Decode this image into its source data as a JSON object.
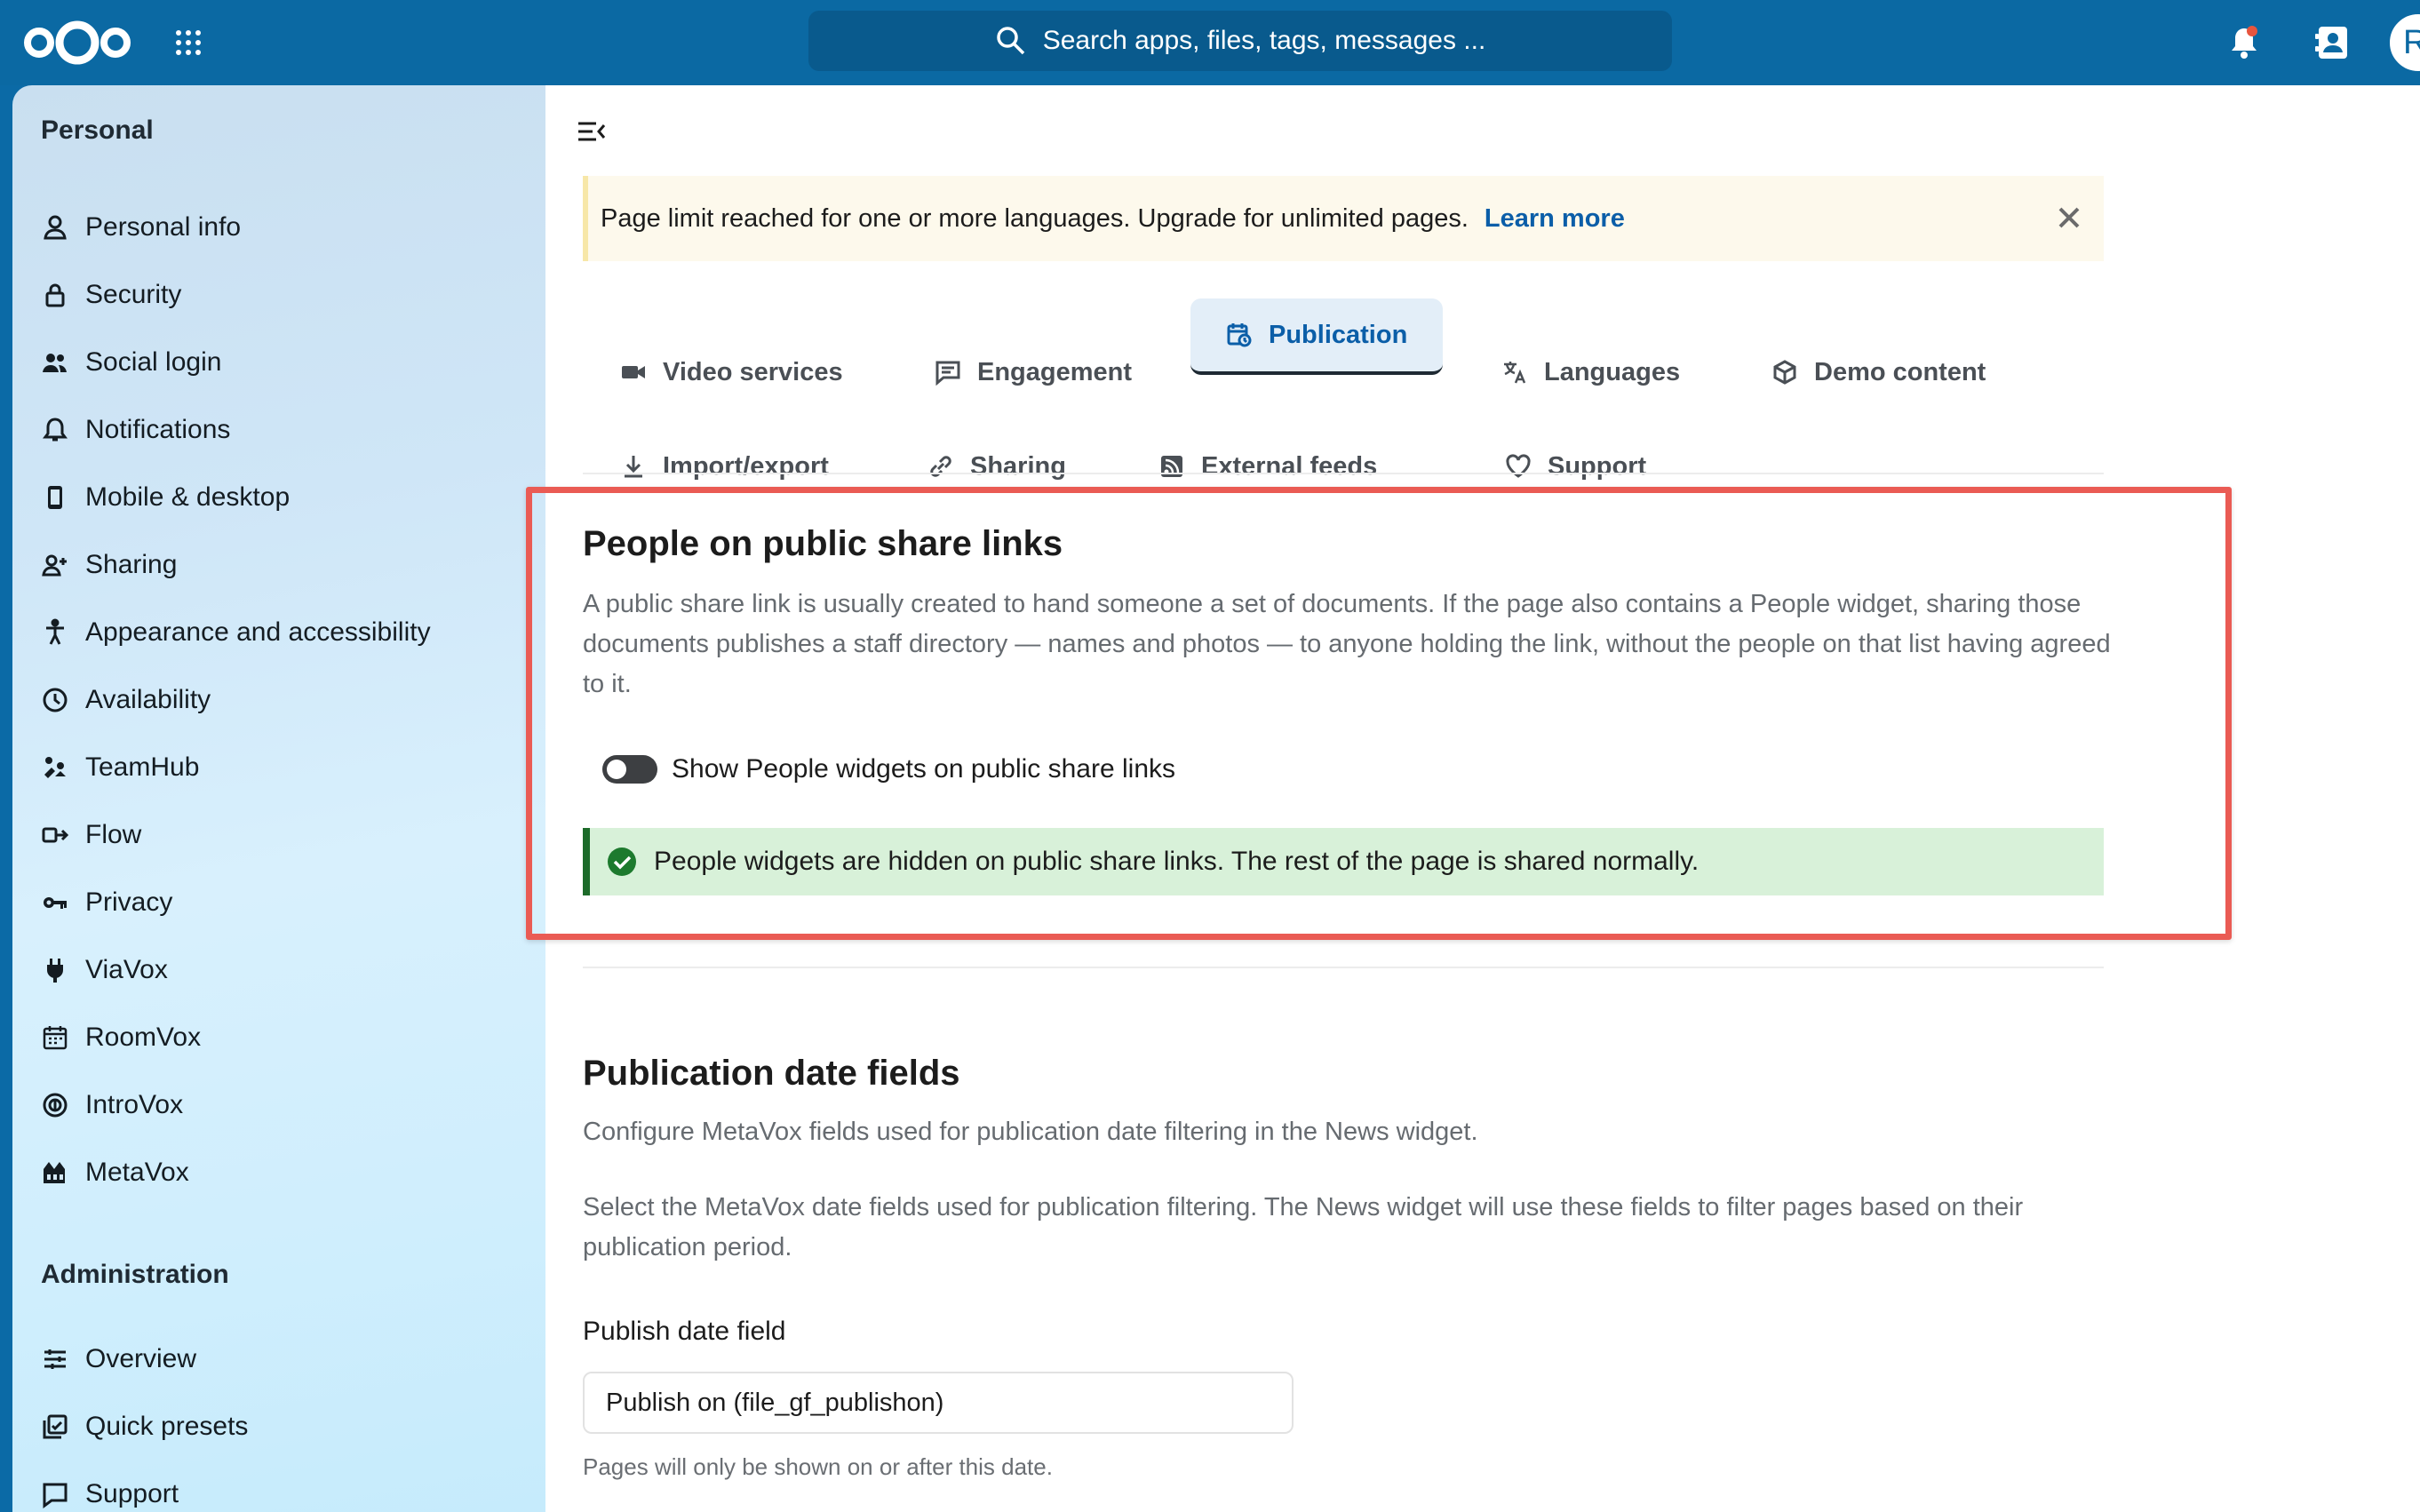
{
  "header": {
    "search_placeholder": "Search apps, files, tags, messages ...",
    "avatar_initial": "R"
  },
  "sidebar": {
    "personal_title": "Personal",
    "personal_items": [
      {
        "label": "Personal info",
        "icon": "user-icon"
      },
      {
        "label": "Security",
        "icon": "lock-icon"
      },
      {
        "label": "Social login",
        "icon": "users-icon"
      },
      {
        "label": "Notifications",
        "icon": "bell-icon"
      },
      {
        "label": "Mobile & desktop",
        "icon": "phone-icon"
      },
      {
        "label": "Sharing",
        "icon": "share-user-icon"
      },
      {
        "label": "Appearance and accessibility",
        "icon": "accessibility-icon"
      },
      {
        "label": "Availability",
        "icon": "clock-icon"
      },
      {
        "label": "TeamHub",
        "icon": "teamhub-icon"
      },
      {
        "label": "Flow",
        "icon": "flow-icon"
      },
      {
        "label": "Privacy",
        "icon": "key-icon"
      },
      {
        "label": "ViaVox",
        "icon": "plug-icon"
      },
      {
        "label": "RoomVox",
        "icon": "calendar-grid-icon"
      },
      {
        "label": "IntroVox",
        "icon": "introvox-icon"
      },
      {
        "label": "MetaVox",
        "icon": "metavox-icon"
      }
    ],
    "admin_title": "Administration",
    "admin_items": [
      {
        "label": "Overview",
        "icon": "sliders-icon"
      },
      {
        "label": "Quick presets",
        "icon": "presets-icon"
      },
      {
        "label": "Support",
        "icon": "support-icon"
      }
    ]
  },
  "banner": {
    "text": "Page limit reached for one or more languages. Upgrade for unlimited pages.",
    "link": "Learn more"
  },
  "tabs": [
    {
      "label": "Video services",
      "icon": "video-icon"
    },
    {
      "label": "Engagement",
      "icon": "comment-icon"
    },
    {
      "label": "Publication",
      "icon": "calendar-clock-icon",
      "active": true
    },
    {
      "label": "Languages",
      "icon": "translate-icon"
    },
    {
      "label": "Demo content",
      "icon": "package-icon"
    },
    {
      "label": "Import/export",
      "icon": "download-icon"
    },
    {
      "label": "Sharing",
      "icon": "link-icon"
    },
    {
      "label": "External feeds",
      "icon": "rss-icon"
    },
    {
      "label": "Support",
      "icon": "heart-icon"
    }
  ],
  "people_section": {
    "title": "People on public share links",
    "description": "A public share link is usually created to hand someone a set of documents. If the page also contains a People widget, sharing those documents publishes a staff directory — names and photos — to anyone holding the link, without the people on that list having agreed to it.",
    "toggle_label": "Show People widgets on public share links",
    "status": "People widgets are hidden on public share links. The rest of the page is shared normally."
  },
  "publication_section": {
    "title": "Publication date fields",
    "intro": "Configure MetaVox fields used for publication date filtering in the News widget.",
    "description": "Select the MetaVox date fields used for publication filtering. The News widget will use these fields to filter pages based on their publication period.",
    "field_label": "Publish date field",
    "field_value": "Publish on (file_gf_publishon)",
    "field_hint": "Pages will only be shown on or after this date."
  },
  "colors": {
    "header": "#0b69a3",
    "accent": "#0b5ea8",
    "highlight": "#ea5b54",
    "success_bg": "#d8f1d9"
  }
}
